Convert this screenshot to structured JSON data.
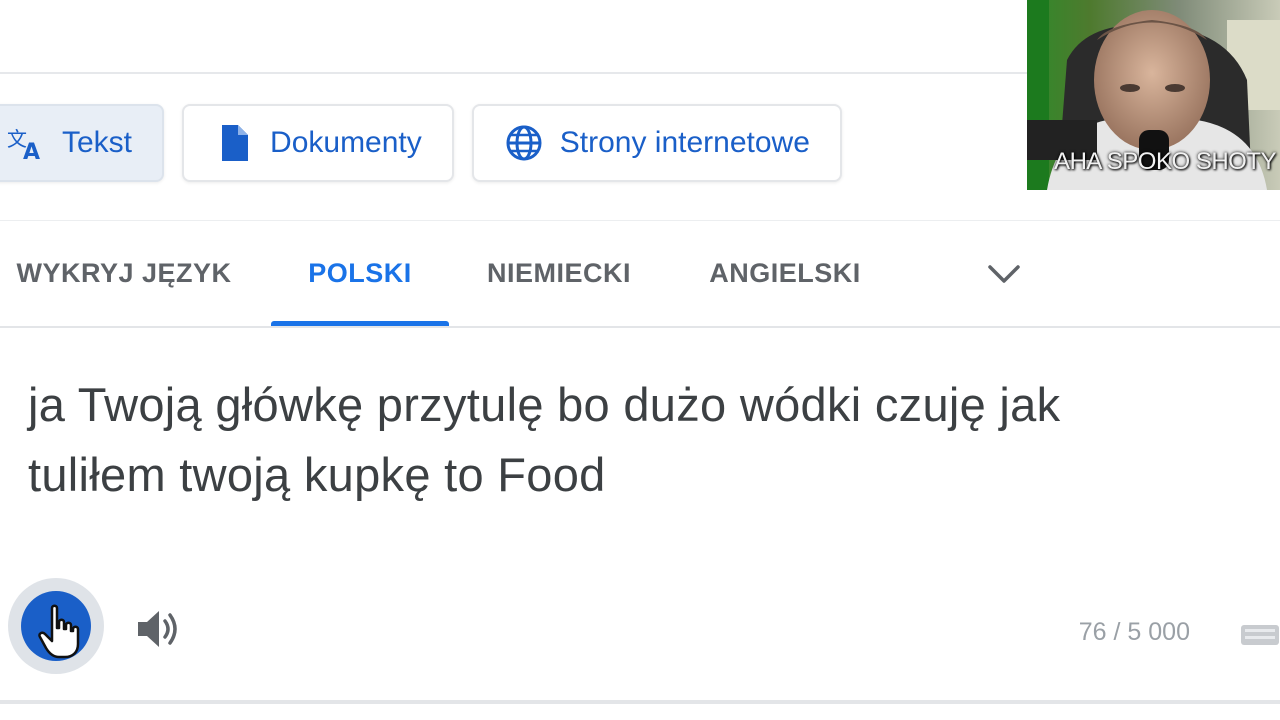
{
  "mode_tabs": [
    {
      "label": "Tekst",
      "icon": "translate-icon"
    },
    {
      "label": "Dokumenty",
      "icon": "document-icon"
    },
    {
      "label": "Strony internetowe",
      "icon": "globe-icon"
    }
  ],
  "languages": {
    "items": [
      "WYKRYJ JĘZYK",
      "POLSKI",
      "NIEMIECKI",
      "ANGIELSKI"
    ],
    "selected": "POLSKI"
  },
  "source": {
    "line1": "ja Twoją główkę przytulę bo dużo wódki czuję jak",
    "line2": "tuliłem twoją kupkę to Food"
  },
  "char_count": "76 / 5 000",
  "webcam": {
    "caption": "AHA SPOKO SHOTY"
  },
  "colors": {
    "accent": "#1a73e8",
    "tab_text": "#1a5fc8",
    "muted_text": "#5f6368",
    "body_text": "#3c4043"
  }
}
